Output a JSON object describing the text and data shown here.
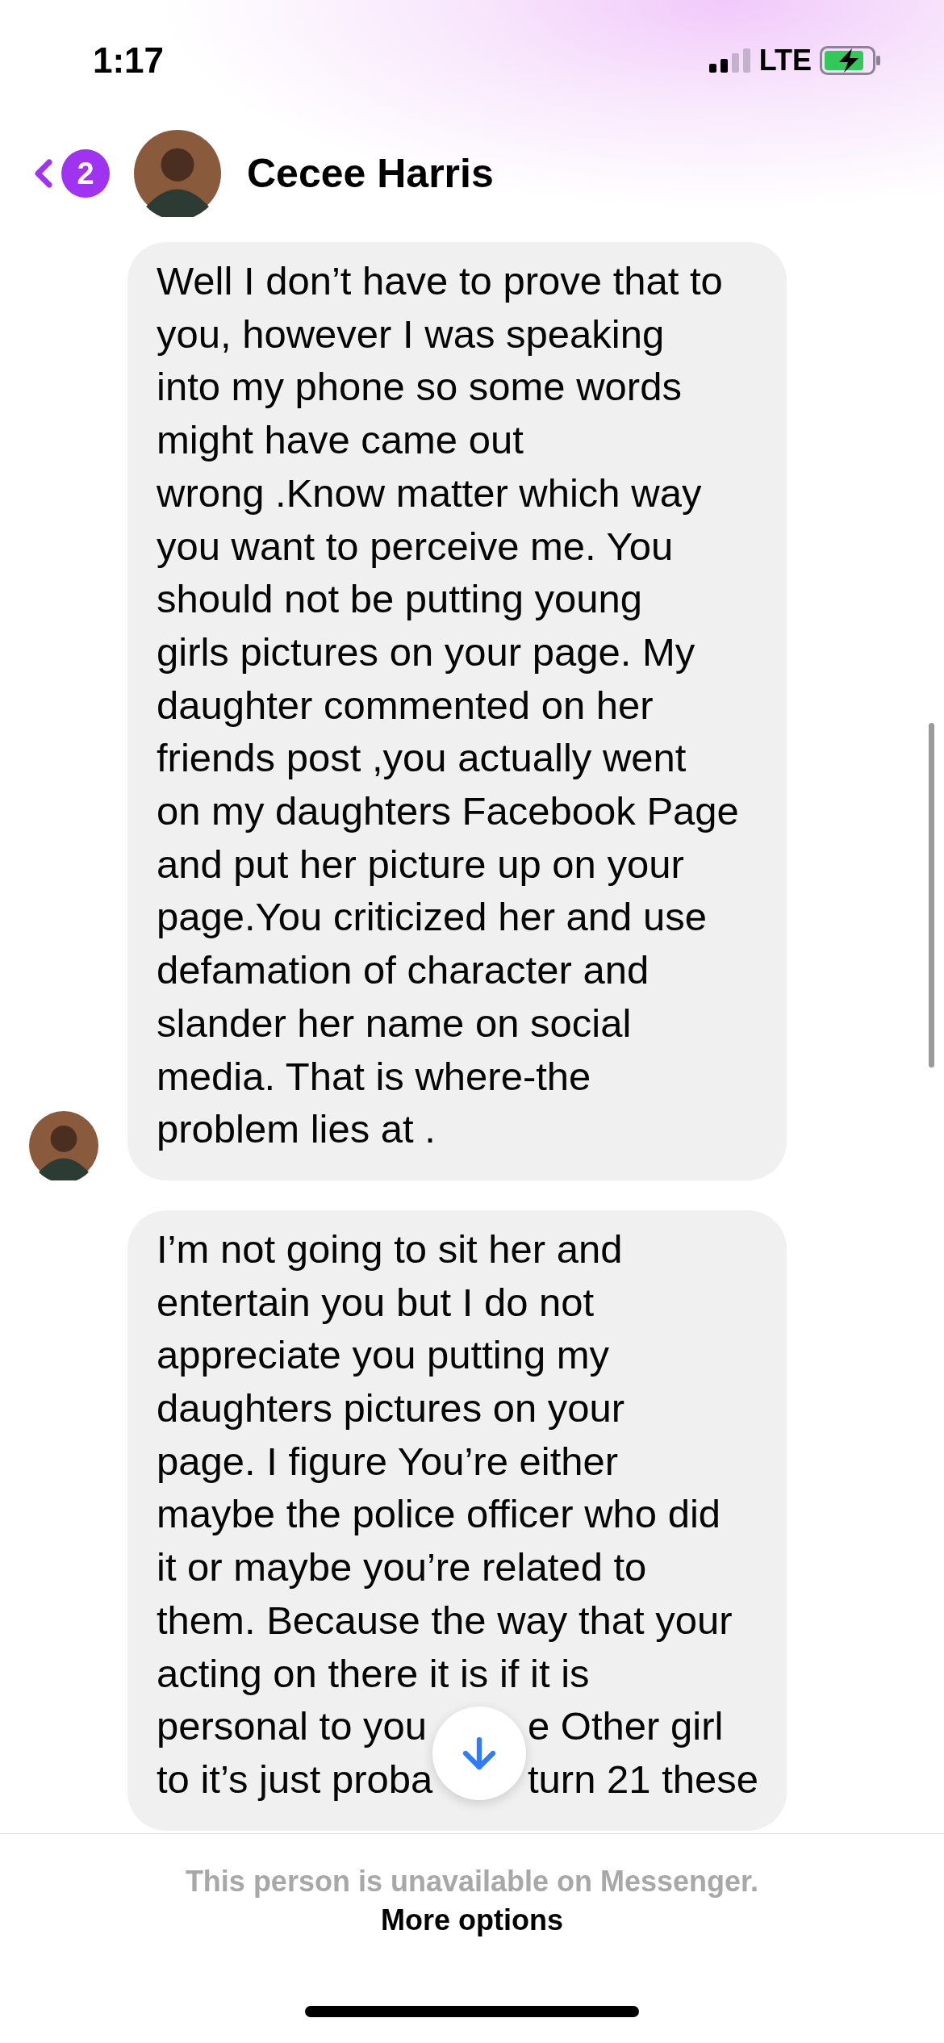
{
  "status_bar": {
    "time": "1:17",
    "network": "LTE"
  },
  "header": {
    "unread_count": "2",
    "name": "Cecee Harris"
  },
  "messages": [
    {
      "sender_avatar": true,
      "lines": [
        "Well I don’t have to prove that to",
        "you, however I was speaking",
        "into my phone so some words",
        "might have came out",
        "wrong .Know matter which way",
        "you want to perceive me. You",
        "should not be putting young",
        "girls pictures on your page. My",
        "daughter commented on her",
        "friends post ,you actually went",
        "on my daughters Facebook Page",
        "and put her picture up on your",
        "page.You criticized her and use",
        "defamation of character and",
        "slander her name on social",
        "media. That is where-the",
        "problem lies at ."
      ]
    },
    {
      "sender_avatar": false,
      "lines": [
        "I’m not going to sit her and",
        "entertain you but I do not",
        "appreciate you putting my",
        "daughters pictures on your",
        "page. I figure You’re either",
        "maybe the police officer who did",
        "it or maybe you’re related to",
        "them. Because the way that your",
        "acting on there it is if it is",
        {
          "parts": [
            "personal to you",
            "e Other girl"
          ]
        },
        {
          "parts": [
            "to it’s just proba",
            "turn 21 these"
          ]
        }
      ]
    }
  ],
  "footer": {
    "notice": "This person is unavailable on Messenger.",
    "action": "More options"
  }
}
